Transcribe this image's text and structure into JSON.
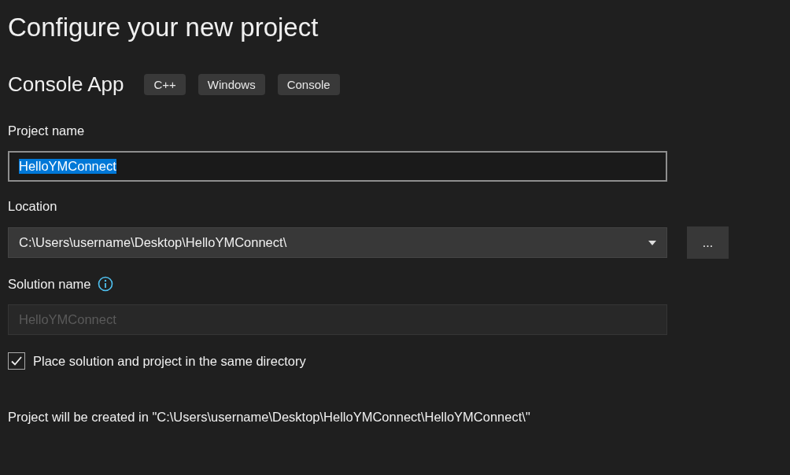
{
  "title": "Configure your new project",
  "template": {
    "name": "Console App",
    "tags": [
      "C++",
      "Windows",
      "Console"
    ]
  },
  "project_name": {
    "label": "Project name",
    "value": "HelloYMConnect",
    "text_selected": true
  },
  "location": {
    "label": "Location",
    "value": "C:\\Users\\username\\Desktop\\HelloYMConnect\\",
    "browse_button": "..."
  },
  "solution_name": {
    "label": "Solution name",
    "value": "HelloYMConnect",
    "disabled": true
  },
  "same_directory": {
    "label": "Place solution and project in the same directory",
    "checked": true
  },
  "footer": "Project will be created in \"C:\\Users\\username\\Desktop\\HelloYMConnect\\HelloYMConnect\\\""
}
